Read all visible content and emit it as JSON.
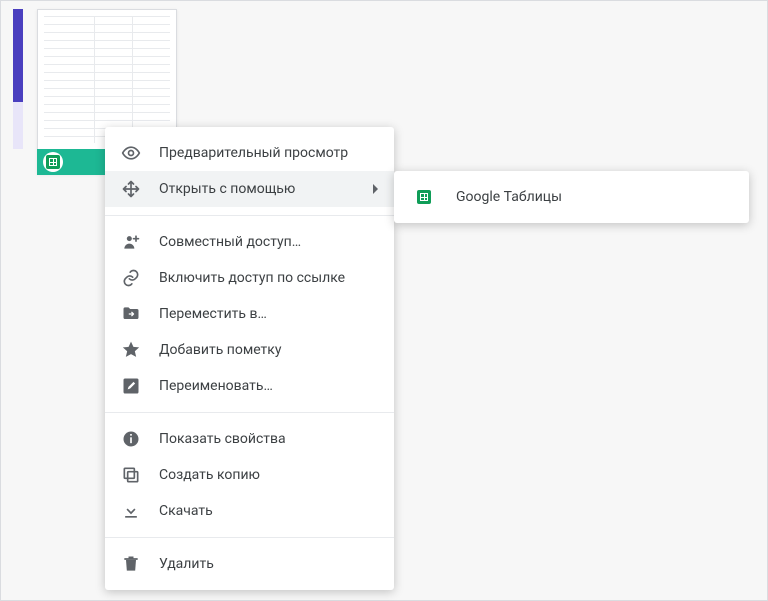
{
  "thumbnail": {
    "selected": true,
    "file_type_icon": "sheets-icon"
  },
  "context_menu": {
    "items": [
      {
        "icon": "eye-icon",
        "label": "Предварительный просмотр"
      },
      {
        "icon": "move-arrows-icon",
        "label": "Открыть с помощью",
        "has_submenu": true,
        "highlighted": true
      }
    ],
    "section2": [
      {
        "icon": "person-plus-icon",
        "label": "Совместный доступ…"
      },
      {
        "icon": "link-icon",
        "label": "Включить доступ по ссылке"
      },
      {
        "icon": "folder-arrow-icon",
        "label": "Переместить в…"
      },
      {
        "icon": "star-icon",
        "label": "Добавить пометку"
      },
      {
        "icon": "rename-icon",
        "label": "Переименовать…"
      }
    ],
    "section3": [
      {
        "icon": "info-icon",
        "label": "Показать свойства"
      },
      {
        "icon": "copy-icon",
        "label": "Создать копию"
      },
      {
        "icon": "download-icon",
        "label": "Скачать"
      }
    ],
    "section4": [
      {
        "icon": "trash-icon",
        "label": "Удалить"
      }
    ]
  },
  "submenu": {
    "items": [
      {
        "icon": "sheets-icon",
        "label": "Google Таблицы"
      }
    ]
  }
}
